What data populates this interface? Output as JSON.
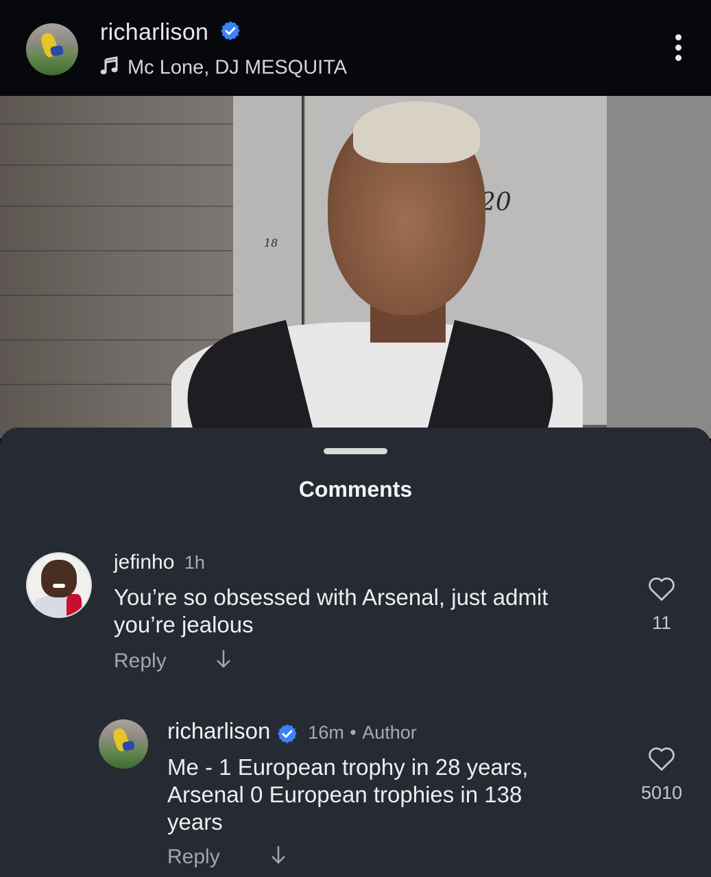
{
  "header": {
    "username": "richarlison",
    "music": "Mc Lone, DJ MESQUITA",
    "verified_color": "#3b82f6"
  },
  "photo": {
    "locker_numbers": [
      "18",
      "20"
    ]
  },
  "comments_sheet": {
    "title": "Comments",
    "comments": [
      {
        "username": "jefinho",
        "time": "1h",
        "text_lines": [
          "You’re so obsessed with Arsenal, just admit",
          "you’re jealous"
        ],
        "reply_label": "Reply",
        "likes": "11",
        "avatar_icon": "profile-photo"
      },
      {
        "username": "richarlison",
        "time": "16m",
        "separator": "•",
        "author_label": "Author",
        "text_lines": [
          "Me - 1 European trophy in 28 years,",
          "Arsenal 0 European trophies in 138",
          "years"
        ],
        "reply_label": "Reply",
        "likes": "5010",
        "avatar_icon": "profile-photo"
      }
    ]
  },
  "icons": {
    "heart": "heart-icon",
    "arrow": "arrow-down-icon",
    "more": "more-vertical-icon",
    "music": "music-note-icon"
  }
}
